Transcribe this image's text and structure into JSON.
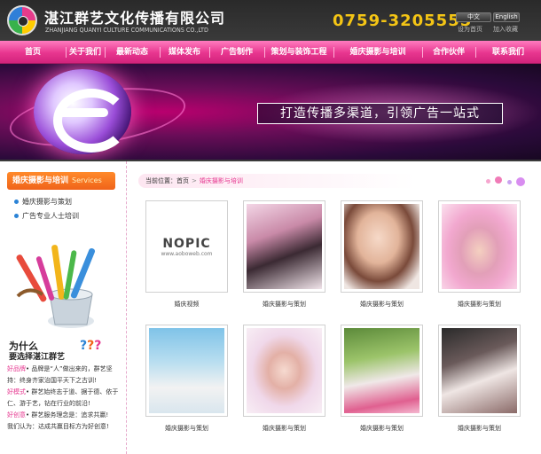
{
  "header": {
    "company_cn": "湛江群艺文化传播有限公司",
    "company_en": "ZHANJIANG QUANYI CULTURE COMMUNICATIONS CO.,LTD",
    "phone": "0759-3205555",
    "lang_cn": "中文",
    "lang_en": "English",
    "set_home": "设为首页",
    "add_fav": "加入收藏"
  },
  "nav": {
    "items": [
      "首页",
      "关于我们",
      "最新动态",
      "媒体发布",
      "广告制作",
      "策划与装饰工程",
      "婚庆摄影与培训",
      "合作伙伴",
      "联系我们"
    ]
  },
  "banner": {
    "slogan": "打造传播多渠道，引领广告一站式"
  },
  "sidebar": {
    "title": "婚庆摄影与培训",
    "title_en": "Services",
    "items": [
      "婚庆摄影与策划",
      "广告专业人士培训"
    ],
    "why_title": "为什么",
    "why_subtitle": "要选择湛江群艺",
    "why_lines": [
      {
        "key": "好品牌",
        "text": "• 品牌是“人”做出来的，群艺坚持：终身齐家治国平天下之古训!"
      },
      {
        "key": "好模式",
        "text": "• 群艺始终志于道、据于德、依于仁、游于艺，钻在行业的前沿!"
      },
      {
        "key": "好创意",
        "text": "• 群艺服务理念是：追求共赢!"
      },
      {
        "key": "",
        "text": "我们认为：达成共赢目标方为好创意!"
      }
    ]
  },
  "breadcrumb": {
    "prefix": "当前位置：",
    "home": "首页",
    "sep": ">",
    "current": "婚庆摄影与培训"
  },
  "gallery": [
    {
      "caption": "婚庆视频",
      "nopic": true,
      "nopic_title": "NOPIC",
      "nopic_url": "www.aoboweb.com"
    },
    {
      "caption": "婚庆摄影与策划"
    },
    {
      "caption": "婚庆摄影与策划"
    },
    {
      "caption": "婚庆摄影与策划"
    },
    {
      "caption": "婚庆摄影与策划"
    },
    {
      "caption": "婚庆摄影与策划"
    },
    {
      "caption": "婚庆摄影与策划"
    },
    {
      "caption": "婚庆摄影与策划"
    }
  ],
  "colors": {
    "accent_pink": "#e6368f",
    "accent_orange": "#f0631a",
    "phone_gold": "#f4c515"
  }
}
